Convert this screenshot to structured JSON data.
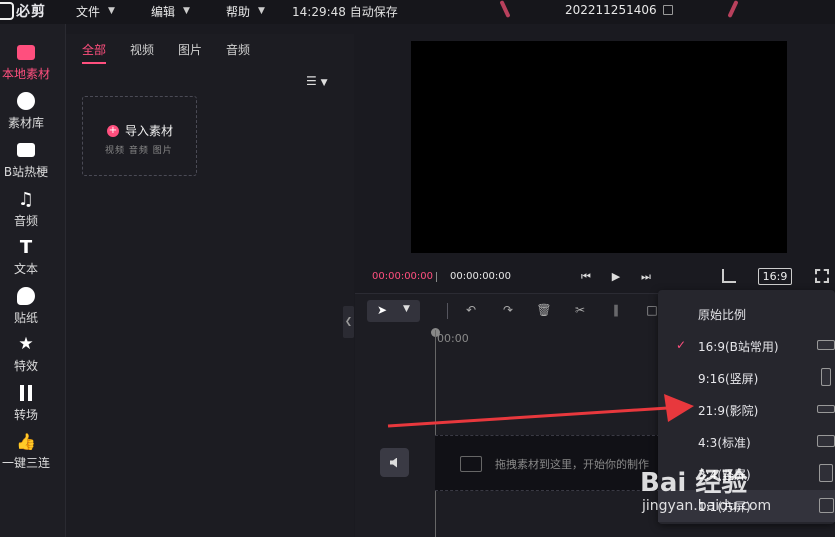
{
  "app": {
    "logo_text": "必剪",
    "menus": [
      {
        "label": "文件"
      },
      {
        "label": "编辑"
      },
      {
        "label": "帮助"
      }
    ],
    "autosave": "14:29:48 自动保存",
    "project_name": "202211251406"
  },
  "sidebar": {
    "items": [
      {
        "label": "本地素材",
        "icon": "upload-icon",
        "active": true
      },
      {
        "label": "素材库",
        "icon": "sticker-face-icon"
      },
      {
        "label": "B站热梗",
        "icon": "bilibili-tv-icon"
      },
      {
        "label": "音频",
        "icon": "music-note-icon"
      },
      {
        "label": "文本",
        "icon": "text-t-icon"
      },
      {
        "label": "贴纸",
        "icon": "sticker-icon"
      },
      {
        "label": "特效",
        "icon": "star-effect-icon"
      },
      {
        "label": "转场",
        "icon": "transition-icon"
      },
      {
        "label": "一键三连",
        "icon": "thumbs-up-icon"
      }
    ]
  },
  "media": {
    "tabs": [
      {
        "label": "全部",
        "active": true
      },
      {
        "label": "视频"
      },
      {
        "label": "图片"
      },
      {
        "label": "音频"
      }
    ],
    "import_label": "导入素材",
    "import_types": "视频  音频  图片"
  },
  "preview": {
    "current_time": "00:00:00:00",
    "total_time": "00:00:00:00",
    "ratio_label": "16:9"
  },
  "timeline": {
    "ruler_start": "00:00",
    "drop_hint": "拖拽素材到这里，开始你的制作"
  },
  "ratio_menu": {
    "options": [
      {
        "label": "原始比例"
      },
      {
        "label": "16:9(B站常用)",
        "selected": true
      },
      {
        "label": "9:16(竖屏)"
      },
      {
        "label": "21:9(影院)"
      },
      {
        "label": "4:3(标准)"
      },
      {
        "label": "3:4(竖屏)"
      },
      {
        "label": "1:1(方屏)"
      }
    ]
  },
  "watermark": {
    "brand": "Bai  经验",
    "url": "jingyan.baidu.com"
  },
  "colors": {
    "accent": "#ff4f7e",
    "annotation_arrow": "#e8383d"
  }
}
